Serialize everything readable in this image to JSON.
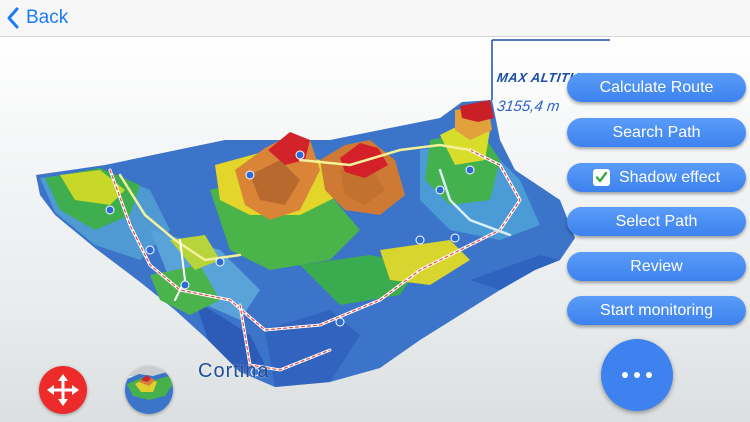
{
  "nav": {
    "back_label": "Back"
  },
  "map": {
    "max_altitude_label": "MAX ALTITUDE",
    "max_altitude_value": "3155,4 m",
    "place_label": "Cortina"
  },
  "menu": {
    "calculate_route": "Calculate Route",
    "search_path": "Search Path",
    "shadow_effect": "Shadow effect",
    "select_path": "Select Path",
    "review": "Review",
    "start_monitoring": "Start monitoring"
  },
  "colors": {
    "accent": "#3d82ef",
    "nav_tint": "#1a7cf5",
    "move_button": "#ee2b2b"
  },
  "icons": {
    "back": "chevron-left-icon",
    "shadow_toggle": "checkmark-icon",
    "move": "move-arrows-icon",
    "more": "ellipsis-icon"
  }
}
